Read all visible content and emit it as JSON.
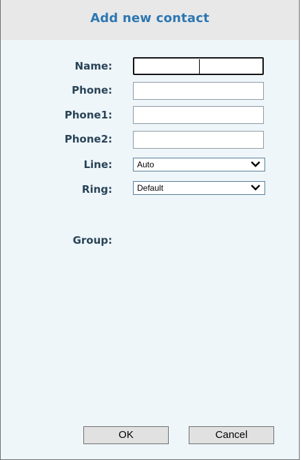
{
  "dialog": {
    "title": "Add new contact"
  },
  "form": {
    "name_label": "Name:",
    "name_value": "",
    "phone_label": "Phone:",
    "phone_value": "",
    "phone1_label": "Phone1:",
    "phone1_value": "",
    "phone2_label": "Phone2:",
    "phone2_value": "",
    "line_label": "Line:",
    "line_selected": "Auto",
    "ring_label": "Ring:",
    "ring_selected": "Default",
    "group_label": "Group:"
  },
  "buttons": {
    "ok_label": "OK",
    "cancel_label": "Cancel"
  },
  "icons": {
    "dropdown": "chevron-down-icon"
  },
  "colors": {
    "title": "#2c77b2",
    "label": "#2a4457",
    "panel_background": "#eef6fa",
    "title_bar_background": "#e8e8e8"
  }
}
